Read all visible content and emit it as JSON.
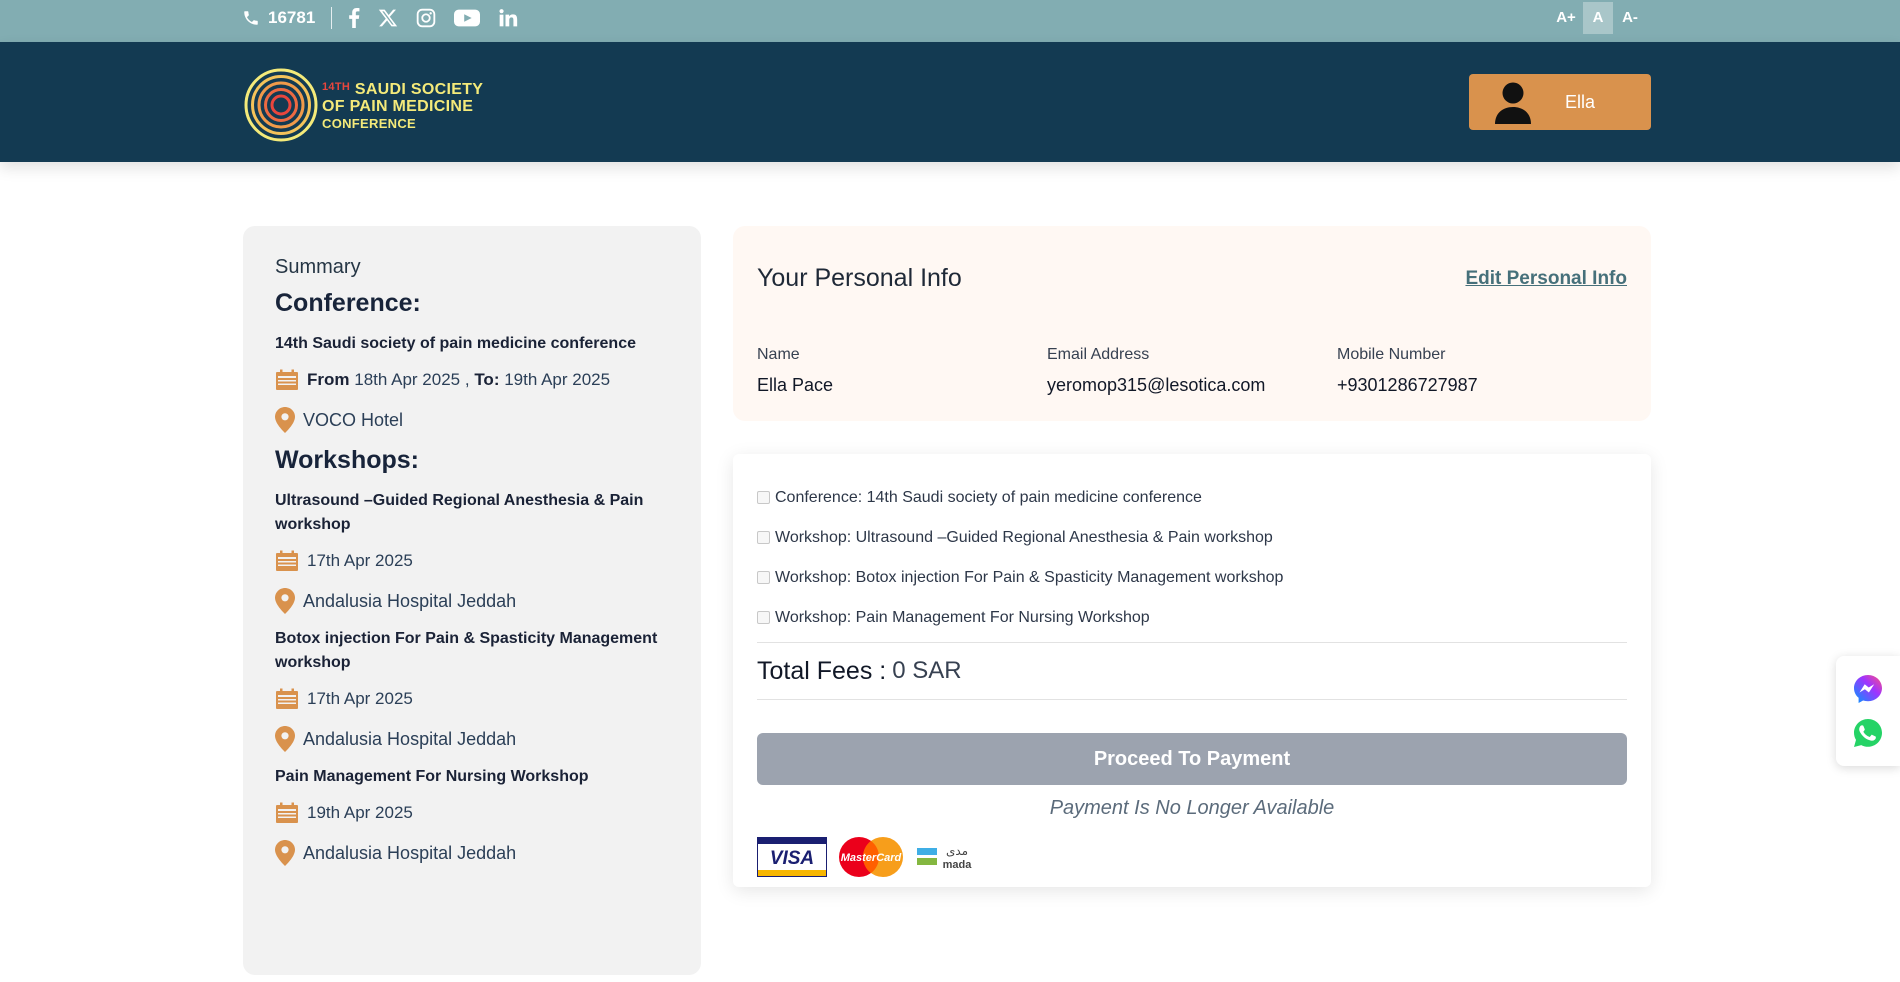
{
  "topbar": {
    "phone": "16781",
    "social_icons": [
      "facebook-icon",
      "x-twitter-icon",
      "instagram-icon",
      "youtube-icon",
      "linkedin-icon"
    ],
    "font_controls": [
      "A+",
      "A",
      "A-"
    ]
  },
  "header": {
    "logo": {
      "line1_num": "14TH",
      "line1": "SAUDI SOCIETY",
      "line2": "OF PAIN MEDICINE",
      "line3": "CONFERENCE"
    },
    "user_name": "Ella"
  },
  "summary": {
    "title": "Summary",
    "conference_heading": "Conference:",
    "conference": {
      "name": "14th Saudi society of pain medicine conference",
      "from_label": "From",
      "from_date": "18th Apr 2025",
      "separator": ",",
      "to_label": "To:",
      "to_date": "19th Apr 2025",
      "location": "VOCO Hotel"
    },
    "workshops_heading": "Workshops:",
    "workshops": [
      {
        "name": "Ultrasound –Guided Regional Anesthesia & Pain workshop",
        "date": "17th Apr 2025",
        "location": "Andalusia Hospital Jeddah"
      },
      {
        "name": "Botox injection For Pain & Spasticity Management workshop",
        "date": "17th Apr 2025",
        "location": "Andalusia Hospital Jeddah"
      },
      {
        "name": "Pain Management For Nursing Workshop",
        "date": "19th Apr 2025",
        "location": "Andalusia Hospital Jeddah"
      }
    ]
  },
  "personal_info": {
    "title": "Your Personal Info",
    "edit_label": "Edit Personal Info",
    "fields": [
      {
        "label": "Name",
        "value": "Ella Pace"
      },
      {
        "label": "Email Address",
        "value": "yeromop315@lesotica.com"
      },
      {
        "label": "Mobile Number",
        "value": "+9301286727987"
      }
    ]
  },
  "registration": {
    "items": [
      "Conference: 14th Saudi society of pain medicine conference",
      "Workshop: Ultrasound –Guided Regional Anesthesia & Pain workshop",
      "Workshop: Botox injection For Pain & Spasticity Management workshop",
      "Workshop: Pain Management For Nursing Workshop"
    ],
    "total_label": "Total Fees :",
    "total_value": "0 SAR",
    "pay_button": "Proceed To Payment",
    "pay_note": "Payment Is No Longer Available",
    "payment_logos": {
      "visa": "VISA",
      "mastercard": "MasterCard",
      "mada_ar": "مدى",
      "mada": "mada"
    }
  },
  "colors": {
    "topbar": "#82adb2",
    "header": "#133a52",
    "accent": "#d9924d",
    "pay_button": "#9ca3af"
  }
}
